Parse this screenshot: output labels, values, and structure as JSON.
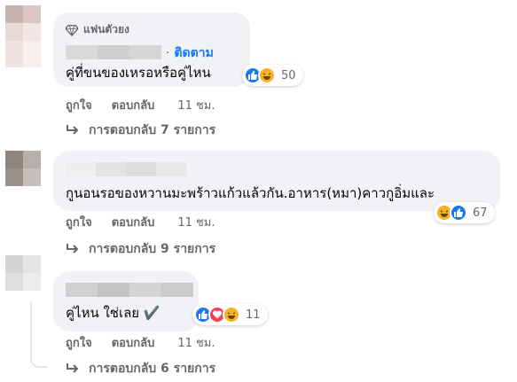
{
  "comments": [
    {
      "badge": "แฟนตัวยง",
      "follow_label": "ติดตาม",
      "text": "คู่ที่ขนของเหรอหรือคู่ไหน",
      "reactions": {
        "count": "50",
        "icons": [
          "like-icon",
          "haha-icon"
        ]
      },
      "actions": {
        "like": "ถูกใจ",
        "reply": "ตอบกลับ",
        "time": "11 ชม."
      },
      "replies_label": "การตอบกลับ 7 รายการ"
    },
    {
      "text": "กูนอนรอของหวานมะพร้าวแก้วแล้วกัน.อาหาร(หมา)คาวกูอิ่มและ",
      "reactions": {
        "count": "67",
        "icons": [
          "haha-icon",
          "like-icon"
        ]
      },
      "actions": {
        "like": "ถูกใจ",
        "reply": "ตอบกลับ",
        "time": "11 ชม."
      },
      "replies_label": "การตอบกลับ 9 รายการ"
    },
    {
      "text": "คู่ไหน ใช่เลย ✔️",
      "reactions": {
        "count": "11",
        "icons": [
          "like-icon",
          "love-icon",
          "haha-icon"
        ]
      },
      "actions": {
        "like": "ถูกใจ",
        "reply": "ตอบกลับ",
        "time": "11 ชม."
      },
      "replies_label": "การตอบกลับ 6 รายการ"
    }
  ],
  "colors": {
    "bubble": "#f0f2f5",
    "secondary_text": "#65676b",
    "link_blue": "#1877f2",
    "like_blue": "#1877f2",
    "love_red": "#f33e58",
    "haha_yellow": "#f7b125"
  }
}
